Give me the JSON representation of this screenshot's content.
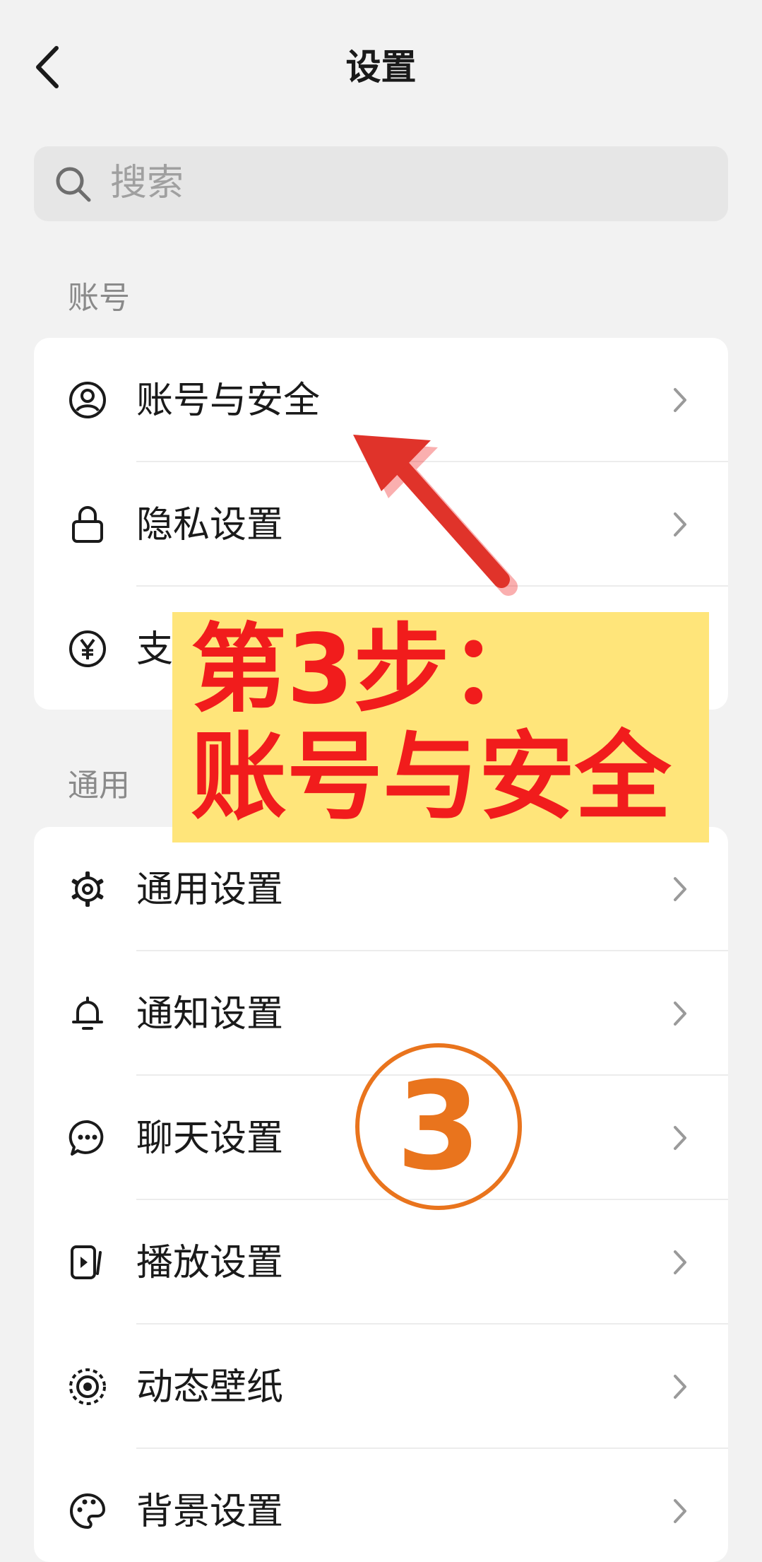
{
  "header": {
    "title": "设置"
  },
  "search": {
    "placeholder": "搜索"
  },
  "sections": {
    "account": {
      "label": "账号",
      "items": [
        {
          "label": "账号与安全",
          "icon": "user-circle-icon"
        },
        {
          "label": "隐私设置",
          "icon": "lock-icon"
        },
        {
          "label": "支",
          "icon": "yen-circle-icon"
        }
      ]
    },
    "general": {
      "label": "通用",
      "items": [
        {
          "label": "通用设置",
          "icon": "gear-icon"
        },
        {
          "label": "通知设置",
          "icon": "bell-icon"
        },
        {
          "label": "聊天设置",
          "icon": "chat-bubble-icon"
        },
        {
          "label": "播放设置",
          "icon": "play-icon"
        },
        {
          "label": "动态壁纸",
          "icon": "wallpaper-icon"
        },
        {
          "label": "背景设置",
          "icon": "palette-icon"
        }
      ]
    }
  },
  "annotation": {
    "line1": "第3步：",
    "line2": "账号与安全",
    "badge": "3",
    "text_color": "#f11c1c",
    "box_color": "#ffe57a",
    "badge_color": "#e9741d"
  }
}
